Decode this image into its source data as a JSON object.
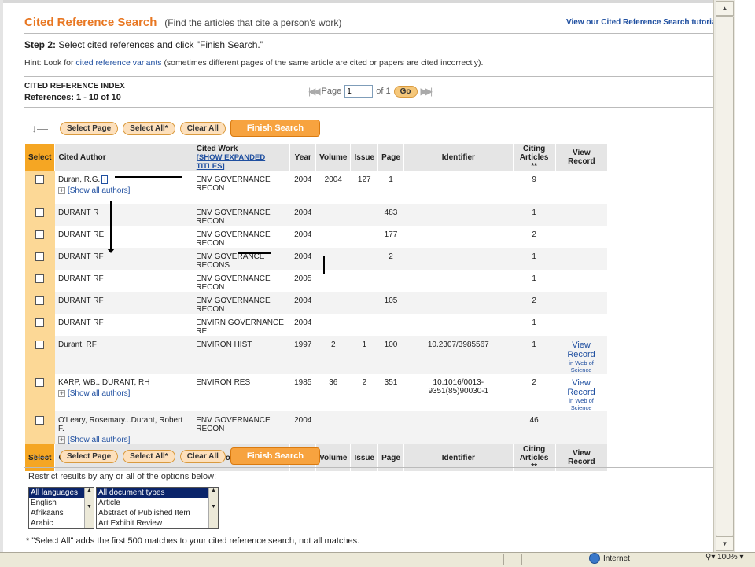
{
  "header": {
    "title": "Cited Reference Search",
    "subtitle": "(Find the articles that cite a person's work)",
    "tutorial_link": "View our Cited Reference Search tutorial."
  },
  "step": {
    "label": "Step 2:",
    "text": "Select cited references and click \"Finish Search.\""
  },
  "hint": {
    "prefix": "Hint: Look for",
    "link": "cited reference variants",
    "suffix": "(sometimes different pages of the same article are cited or papers are cited incorrectly)."
  },
  "index": {
    "title": "CITED REFERENCE INDEX",
    "count": "References:  1 - 10 of   10"
  },
  "pager": {
    "page_label": "Page",
    "page_value": "1",
    "of_label": "of 1",
    "go": "Go"
  },
  "buttons": {
    "select_page": "Select Page",
    "select_all": "Select All*",
    "clear_all": "Clear All",
    "finish": "Finish Search"
  },
  "columns": {
    "select": "Select",
    "cited_author": "Cited Author",
    "cited_work": "Cited Work",
    "show_expanded": "[SHOW EXPANDED TITLES]",
    "year": "Year",
    "volume": "Volume",
    "issue": "Issue",
    "page": "Page",
    "identifier": "Identifier",
    "citing_articles": "Citing Articles **",
    "view_record": "View Record"
  },
  "rows": [
    {
      "author": "Duran, R.G.",
      "info": "i",
      "show_all": "[Show all authors]",
      "work": "ENV GOVERNANCE RECON",
      "year": "2004",
      "volume": "2004",
      "issue": "127",
      "page": "1",
      "identifier": "",
      "citing": "9",
      "view": "",
      "view_sub": ""
    },
    {
      "author": "DURANT R",
      "info": "",
      "show_all": "",
      "work": "ENV GOVERNANCE RECON",
      "year": "2004",
      "volume": "",
      "issue": "",
      "page": "483",
      "identifier": "",
      "citing": "1",
      "view": "",
      "view_sub": ""
    },
    {
      "author": "DURANT RE",
      "info": "",
      "show_all": "",
      "work": "ENV GOVERNANCE RECON",
      "year": "2004",
      "volume": "",
      "issue": "",
      "page": "177",
      "identifier": "",
      "citing": "2",
      "view": "",
      "view_sub": ""
    },
    {
      "author": "DURANT RF",
      "info": "",
      "show_all": "",
      "work": "ENV GOVERANCE RECONS",
      "year": "2004",
      "volume": "",
      "issue": "",
      "page": "2",
      "identifier": "",
      "citing": "1",
      "view": "",
      "view_sub": ""
    },
    {
      "author": "DURANT RF",
      "info": "",
      "show_all": "",
      "work": "ENV GOVERNANCE RECON",
      "year": "2005",
      "volume": "",
      "issue": "",
      "page": "",
      "identifier": "",
      "citing": "1",
      "view": "",
      "view_sub": ""
    },
    {
      "author": "DURANT RF",
      "info": "",
      "show_all": "",
      "work": "ENV GOVERNANCE RECON",
      "year": "2004",
      "volume": "",
      "issue": "",
      "page": "105",
      "identifier": "",
      "citing": "2",
      "view": "",
      "view_sub": ""
    },
    {
      "author": "DURANT RF",
      "info": "",
      "show_all": "",
      "work": "ENVIRN GOVERNANCE RE",
      "year": "2004",
      "volume": "",
      "issue": "",
      "page": "",
      "identifier": "",
      "citing": "1",
      "view": "",
      "view_sub": ""
    },
    {
      "author": "Durant, RF",
      "info": "",
      "show_all": "",
      "work": "ENVIRON HIST",
      "year": "1997",
      "volume": "2",
      "issue": "1",
      "page": "100",
      "identifier": "10.2307/3985567",
      "citing": "1",
      "view": "View Record",
      "view_sub": "in Web of Science"
    },
    {
      "author": "KARP, WB...DURANT, RH",
      "info": "",
      "show_all": "[Show all authors]",
      "work": "ENVIRON RES",
      "year": "1985",
      "volume": "36",
      "issue": "2",
      "page": "351",
      "identifier": "10.1016/0013-9351(85)90030-1",
      "citing": "2",
      "view": "View Record",
      "view_sub": "in Web of Science"
    },
    {
      "author": "O'Leary, Rosemary...Durant, Robert F.",
      "info": "",
      "show_all": "[Show all authors]",
      "work": "ENV GOVERNANCE RECON",
      "year": "2004",
      "volume": "",
      "issue": "",
      "page": "",
      "identifier": "",
      "citing": "46",
      "view": "",
      "view_sub": ""
    }
  ],
  "restrict": {
    "label": "Restrict results by any or all of the options below:",
    "languages": [
      "All languages",
      "English",
      "Afrikaans",
      "Arabic"
    ],
    "doc_types": [
      "All document types",
      "Article",
      "Abstract of Published Item",
      "Art Exhibit Review"
    ]
  },
  "footnote": "* \"Select All\" adds the first 500 matches to your cited reference search, not all matches.",
  "status": {
    "zone": "Internet",
    "zoom": "100%"
  },
  "colors": {
    "accent": "#e87722",
    "select_col": "#f5a623",
    "link": "#1f4fa0"
  }
}
